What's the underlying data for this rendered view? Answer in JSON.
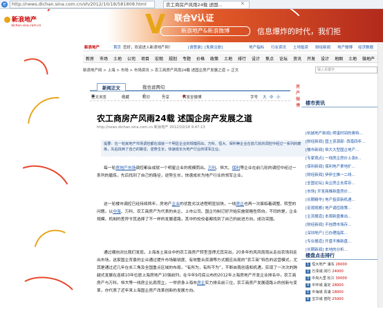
{
  "browser": {
    "url": "http://news.dichan.sina.com.cn/sh/2012/10/18/581808.html",
    "tab_title": "农工商房产风雨24载 述国...",
    "tab_close": "×"
  },
  "banner": {
    "logo": "新浪地产",
    "logo_sub": "dichan.sina.com.cn",
    "v_letter": "V",
    "headline": "联合V认证",
    "subline": "新浪地产&新浪微博",
    "slogan": "信息爆炸的时代，我们拒"
  },
  "top_nav": {
    "logo": "新浪地产",
    "homepage": "首页",
    "welcome": "您好，欢迎进入新浪地产网！",
    "login": "[请登录]",
    "register": "[免费注册]",
    "links": [
      "地产指标",
      "行业资讯",
      "土地投资",
      "财经新闻",
      "地产微博",
      "经济数据"
    ]
  },
  "main_nav": {
    "items": [
      "新房",
      "市场",
      "土地",
      "公司",
      "项目",
      "宏观",
      "规划",
      "专题",
      "价格",
      "政策",
      "土地",
      "排行",
      "设计",
      "焦点",
      "论坛",
      "资讯",
      "开发",
      "设计",
      "地图",
      "土地",
      "微地产"
    ]
  },
  "breadcrumb": {
    "text": "新浪地产网 > 上海 > 市场 > 市场资讯 > 农工商房产风雨24载 述国企房产发展之道 > 正文",
    "search_placeholder": "输入关键字"
  },
  "tabs": {
    "active": "新闻正文",
    "inactive": "我也说两句",
    "weibo": "房产微博"
  },
  "toolbar": {
    "fulltext": "全文浏览",
    "favorite": "收藏",
    "print": "打印",
    "share": "分享",
    "weibo": "转发至微博",
    "font_label": "字号",
    "font_big": "大",
    "font_mid": "中",
    "font_small": "小"
  },
  "article": {
    "title": "农工商房产风雨24载 述国企房产发展之道",
    "meta": "http://news.dichan.sina.com.cn   新浪地产   2012/10/18 9:47:13",
    "summary": "提要：在一轮房地产市场调控都在成就一个明显企业的规模而出，万科、恒大、保利等企业在前几轮的调控中经过一系列的磨炼，先后找到了自己的路径，逆势生长，快速成长为地产行业的领军企业。",
    "p1_a": "每一轮",
    "p1_link1": "房地产市场",
    "p1_b": "调控都会成就一个明星企业的规模而出。",
    "p1_link2": "万科",
    "p1_c": "、恒大、",
    "p1_link3": "保利",
    "p1_d": "等企业在前几轮的调控中经过一系列的磨炼，先后找到了自己的路径，逆势生长，快速成长为地产行业的领军企业。",
    "p2_a": "这一轮楼市调控已经持续两年，房地产",
    "p2_link1": "企业",
    "p2_b": "的优胜劣汰进程明显加快，一线",
    "p2_link2": "房企",
    "p2_c": "也再一次面临着调整、转型的问题。以",
    "p2_link3": "中海",
    "p2_d": "、万科、农工商房产为代表的央企、上市公司、国企均制订好开始实施就略性转向。不同的是，企业规模、机制的差异令其选择了不一样的发展道路，其中的佼佼者都找到了自己的前进方向，成功突围。",
    "p3": "通过横向对比我们发现，上海本土商业中的农工商房产转型显得尤其突出，20多年的风风雨雨从走出农场到走出市场，这家国企背景的企业通过提升市场敏锐度、有效整合资源等方式顺应出现的“农工商”特色的运营模式，尤其是通过近几年在长三角及全国重点区域的布局，“有所为，有所不为”，不断自我创造和机遇，实现了一次次的跨越式发展在连续10年位居上海房地产10强前列，在今年9月底公布的2012年上海房地产开发企业排名中，农工商房产与万科、恒大等一线房企比肩而立，一举挤身上海市",
    "p3_link": "房企",
    "p3_b": "实力排名前三位，农工商房产发展道路上的创新与变革，亦代表了近年来上海国企房产改革创新的发展方向。"
  },
  "right_col": {
    "news_title": "楼市资讯",
    "news_items": [
      "[杭城地产新闻] 明溪时间的奥特...",
      "[财经新闻] 国土资源部: 西南四年...",
      "[楼市新闻] 恒大大型国企地产...",
      "[专家观点] 一线房企房价上涨8...",
      "[保利新闻] 保利地产拿地扩...",
      "[财经新闻] 伊伊主推一二线...",
      "[全国论坛] 央企房企去库存...",
      "[市场] 开发商推新盘房价...",
      "[长期精华] 地产投资新机遇...",
      "[宏观观察] 地产调控政策...",
      "[主流报道] 本周新盘推出...",
      "[财经新闻] 不挂牌市场存...",
      "[深圳地产] 已办理指挥...",
      "[专业报道] 开盘不推新盘...",
      "[长期新闻] 本地的分析...",
      "[热点新闻] 恒大地产的...",
      "[会议中心] 五大网站..."
    ],
    "rank_title": "楼盘点击排行",
    "ranks": [
      {
        "no": "1",
        "name": "恒大地产",
        "area": "浦东",
        "price": "26000"
      },
      {
        "no": "2",
        "name": "万泽城",
        "area": "闵行",
        "price": "24000"
      },
      {
        "no": "3",
        "name": "中央九里",
        "area": "松江",
        "price": "30000"
      },
      {
        "no": "4",
        "name": "中环城",
        "area": "嘉定",
        "price": "28000"
      },
      {
        "no": "5",
        "name": "中海城",
        "area": "青浦",
        "price": "18000"
      },
      {
        "no": "6",
        "name": "宝华城",
        "area": "普陀",
        "price": "25000"
      },
      {
        "no": "7",
        "name": "中环翠",
        "area": "闸北",
        "price": "33000"
      }
    ]
  },
  "colors": {
    "link": "#1b55a8",
    "banner_red": "#b22a1c",
    "banner_gold": "#e8a51a",
    "nav_blue": "#7ca1c9"
  }
}
